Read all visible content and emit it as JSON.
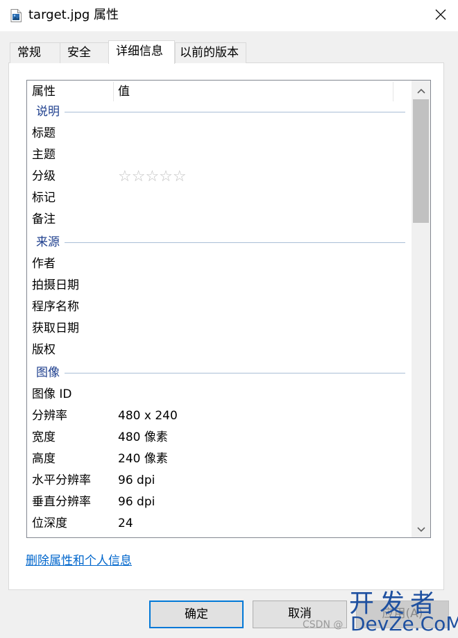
{
  "window": {
    "title": "target.jpg 属性",
    "close_glyph": "✕"
  },
  "tabs": [
    {
      "label": "常规"
    },
    {
      "label": "安全"
    },
    {
      "label": "详细信息"
    },
    {
      "label": "以前的版本"
    }
  ],
  "details": {
    "header_name": "属性",
    "header_value": "值",
    "groups": {
      "description": "说明",
      "origin": "来源",
      "image": "图像"
    },
    "rows": {
      "title": {
        "k": "标题",
        "v": ""
      },
      "subject": {
        "k": "主题",
        "v": ""
      },
      "rating": {
        "k": "分级",
        "stars": "☆☆☆☆☆"
      },
      "tags": {
        "k": "标记",
        "v": ""
      },
      "comments": {
        "k": "备注",
        "v": ""
      },
      "author": {
        "k": "作者",
        "v": ""
      },
      "date_taken": {
        "k": "拍摄日期",
        "v": ""
      },
      "program": {
        "k": "程序名称",
        "v": ""
      },
      "date_acquired": {
        "k": "获取日期",
        "v": ""
      },
      "copyright": {
        "k": "版权",
        "v": ""
      },
      "image_id": {
        "k": "图像 ID",
        "v": ""
      },
      "dimensions": {
        "k": "分辨率",
        "v": "480 x 240"
      },
      "width": {
        "k": "宽度",
        "v": "480 像素"
      },
      "height": {
        "k": "高度",
        "v": "240 像素"
      },
      "hres": {
        "k": "水平分辨率",
        "v": "96 dpi"
      },
      "vres": {
        "k": "垂直分辨率",
        "v": "96 dpi"
      },
      "bitdepth": {
        "k": "位深度",
        "v": "24"
      }
    }
  },
  "remove_link": "删除属性和个人信息",
  "buttons": {
    "ok": "确定",
    "cancel": "取消",
    "apply": "应用(A)"
  },
  "watermark": {
    "big": "开发者",
    "small_prefix": "CSDN @",
    "small_brand": "DevZe.CoM"
  },
  "colors": {
    "link": "#0066cc",
    "group_text": "#1e3f8e",
    "primary_border": "#0078d7"
  }
}
